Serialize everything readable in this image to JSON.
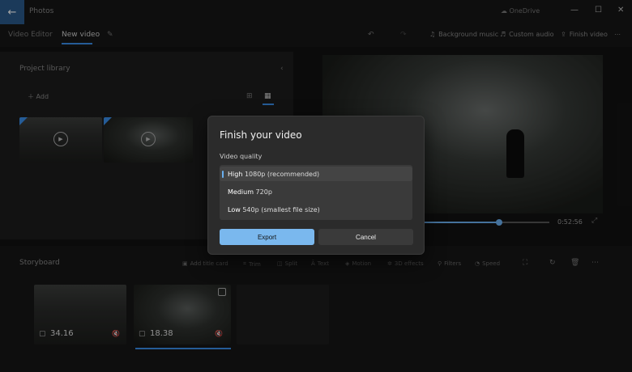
{
  "titlebar": {
    "app_title": "Photos",
    "onedrive": "OneDrive"
  },
  "menubar": {
    "video_editor": "Video Editor",
    "new_video": "New video"
  },
  "toolbar": {
    "background_music": "Background music",
    "custom_audio": "Custom audio",
    "finish_video": "Finish video"
  },
  "project_library": {
    "title": "Project library",
    "add_label": "Add"
  },
  "preview": {
    "time": "0:52:56",
    "progress": 0.6
  },
  "storyboard": {
    "title": "Storyboard",
    "tools": [
      "Add title card",
      "Trim",
      "Split",
      "Text",
      "Motion",
      "3D effects",
      "Filters",
      "Speed"
    ],
    "clips": [
      {
        "duration": "34.16"
      },
      {
        "duration": "18.38"
      }
    ]
  },
  "dialog": {
    "title": "Finish your video",
    "quality_label": "Video quality",
    "options": [
      {
        "name": "High",
        "detail": "1080p (recommended)"
      },
      {
        "name": "Medium",
        "detail": "720p"
      },
      {
        "name": "Low",
        "detail": "540p (smallest file size)"
      }
    ],
    "export_label": "Export",
    "cancel_label": "Cancel"
  }
}
